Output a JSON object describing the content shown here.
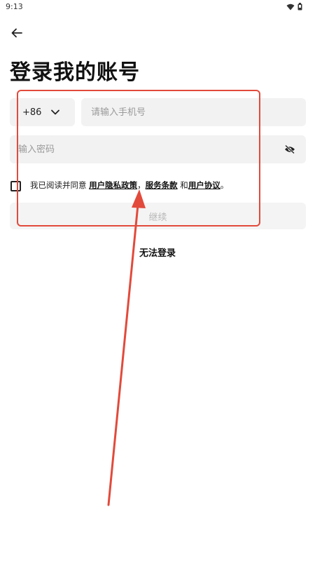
{
  "status_bar": {
    "time": "9:13",
    "wifi_icon": "wifi-icon",
    "battery_icon": "battery-icon"
  },
  "header": {
    "back_icon": "arrow-left-icon",
    "title": "登录我的账号"
  },
  "form": {
    "country_code": "+86",
    "phone_placeholder": "请输入手机号",
    "password_placeholder": "输入密码",
    "agreement": {
      "prefix": "我已阅读并同意 ",
      "privacy_link": "用户隐私政策",
      "sep1": "，",
      "terms_link": "服务条款",
      "and": " 和",
      "user_agreement_link": "用户协议",
      "end": "。"
    },
    "continue_label": "继续"
  },
  "cant_login_label": "无法登录",
  "colors": {
    "annotation": "#e24a3b",
    "input_bg": "#f2f2f2",
    "disabled_text": "#b8b8b8"
  }
}
